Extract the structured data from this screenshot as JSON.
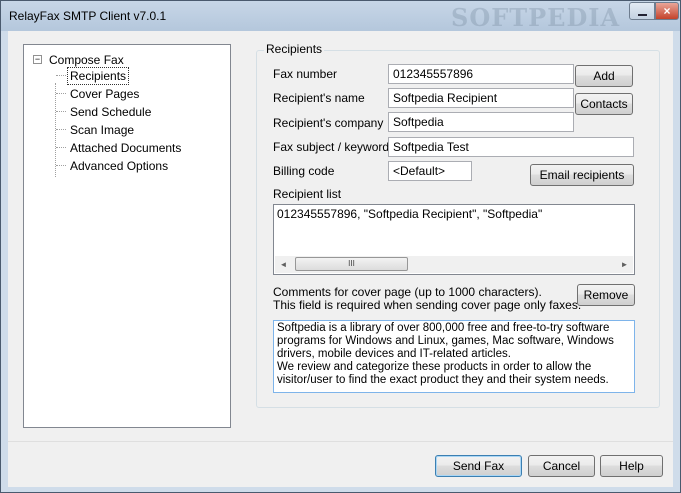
{
  "window": {
    "title": "RelayFax SMTP Client v7.0.1",
    "watermark": "SOFTPEDIA",
    "close_glyph": "×"
  },
  "tree": {
    "root_label": "Compose Fax",
    "expander": "−",
    "items": [
      {
        "label": "Recipients",
        "selected": true
      },
      {
        "label": "Cover Pages"
      },
      {
        "label": "Send Schedule"
      },
      {
        "label": "Scan Image"
      },
      {
        "label": "Attached Documents"
      },
      {
        "label": "Advanced Options"
      }
    ]
  },
  "recipients": {
    "group_label": "Recipients",
    "fax_number_label": "Fax number",
    "fax_number_value": "012345557896",
    "name_label": "Recipient's name",
    "name_value": "Softpedia Recipient",
    "company_label": "Recipient's company",
    "company_value": "Softpedia",
    "subject_label": "Fax subject / keyword",
    "subject_value": "Softpedia Test",
    "billing_label": "Billing code",
    "billing_value": "<Default>",
    "add_button": "Add",
    "contacts_button": "Contacts",
    "email_button": "Email recipients",
    "list_label": "Recipient list",
    "list_items": [
      "012345557896, \"Softpedia Recipient\", \"Softpedia\""
    ],
    "scroll_left": "◄",
    "scroll_right": "►",
    "scroll_thumb": "III",
    "comments_label_line1": "Comments for cover page (up to 1000 characters).",
    "comments_label_line2": "This field is required when sending cover page only faxes.",
    "remove_button": "Remove",
    "comments_text": "Softpedia is a library of over 800,000 free and free-to-try software programs for Windows and Linux, games, Mac software, Windows drivers, mobile devices and IT-related articles.\nWe review and categorize these products in order to allow the visitor/user to find the exact product they and their system needs."
  },
  "footer": {
    "send_button": "Send Fax",
    "cancel_button": "Cancel",
    "help_button": "Help"
  }
}
